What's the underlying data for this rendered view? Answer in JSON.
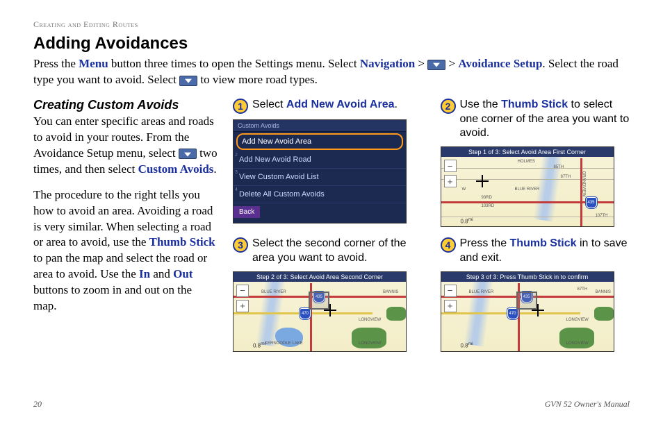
{
  "header": "Creating and Editing Routes",
  "title": "Adding Avoidances",
  "intro": {
    "t1": "Press the ",
    "menu": "Menu",
    "t2": " button three times to open the Settings menu. Select ",
    "nav": "Navigation",
    "gt": " > ",
    "gt2": " > ",
    "avoid": "Avoidance Setup",
    "t3": ". Select the road type you want to avoid. Select ",
    "t4": " to view more road types."
  },
  "sub": {
    "heading": "Creating Custom Avoids",
    "p1a": "You can enter specific areas and roads to avoid in your routes. From the Avoidance Setup menu, select ",
    "p1b": " two times, and then select ",
    "custom": "Custom Avoids",
    "p1c": ".",
    "p2a": "The procedure to the right tells you how to avoid an area. Avoiding a road is very similar. When selecting a road or area to avoid, use the ",
    "thumb": "Thumb Stick",
    "p2b": " to pan the map and select the road or area to avoid. Use the ",
    "in": "In",
    "and": " and ",
    "out": "Out",
    "p2c": " buttons to zoom in and out on the map."
  },
  "steps": {
    "s1": {
      "num": "1",
      "a": "Select ",
      "b": "Add New Avoid Area",
      "c": "."
    },
    "s2": {
      "num": "2",
      "a": "Use the ",
      "b": "Thumb Stick",
      "c": " to select one corner of the area you want to avoid."
    },
    "s3": {
      "num": "3",
      "a": "Select the second corner of the area you want to avoid."
    },
    "s4": {
      "num": "4",
      "a": "Press the ",
      "b": "Thumb Stick",
      "c": " in to save and exit."
    }
  },
  "menu": {
    "title": "Custom Avoids",
    "items": [
      "Add New Avoid Area",
      "Add New Avoid Road",
      "View Custom Avoid List",
      "Delete All Custom Avoids"
    ],
    "back": "Back"
  },
  "maps": {
    "h1": "Step 1 of 3: Select Avoid Area First Corner",
    "h2": "Step 2 of 3: Select Avoid Area Second Corner",
    "h3": "Step 3 of 3: Press Thumb Stick in to confirm",
    "scale": "0.8",
    "unit": "mi",
    "labels": {
      "blueriver": "BLUE RIVER",
      "longview": "LONGVIEW",
      "kernoodle": "KERNOODLE LAKE",
      "bannis": "BANNIS",
      "holmes": "HOLMES",
      "grandview": "GRANDVIEW",
      "s103": "103RD",
      "s107": "107TH",
      "s85": "85TH",
      "s87": "87TH",
      "s93": "93RD",
      "w": "W"
    },
    "shields": {
      "i435": "435",
      "i470": "470"
    }
  },
  "footer": {
    "page": "20",
    "manual": "GVN 52 Owner's Manual"
  }
}
